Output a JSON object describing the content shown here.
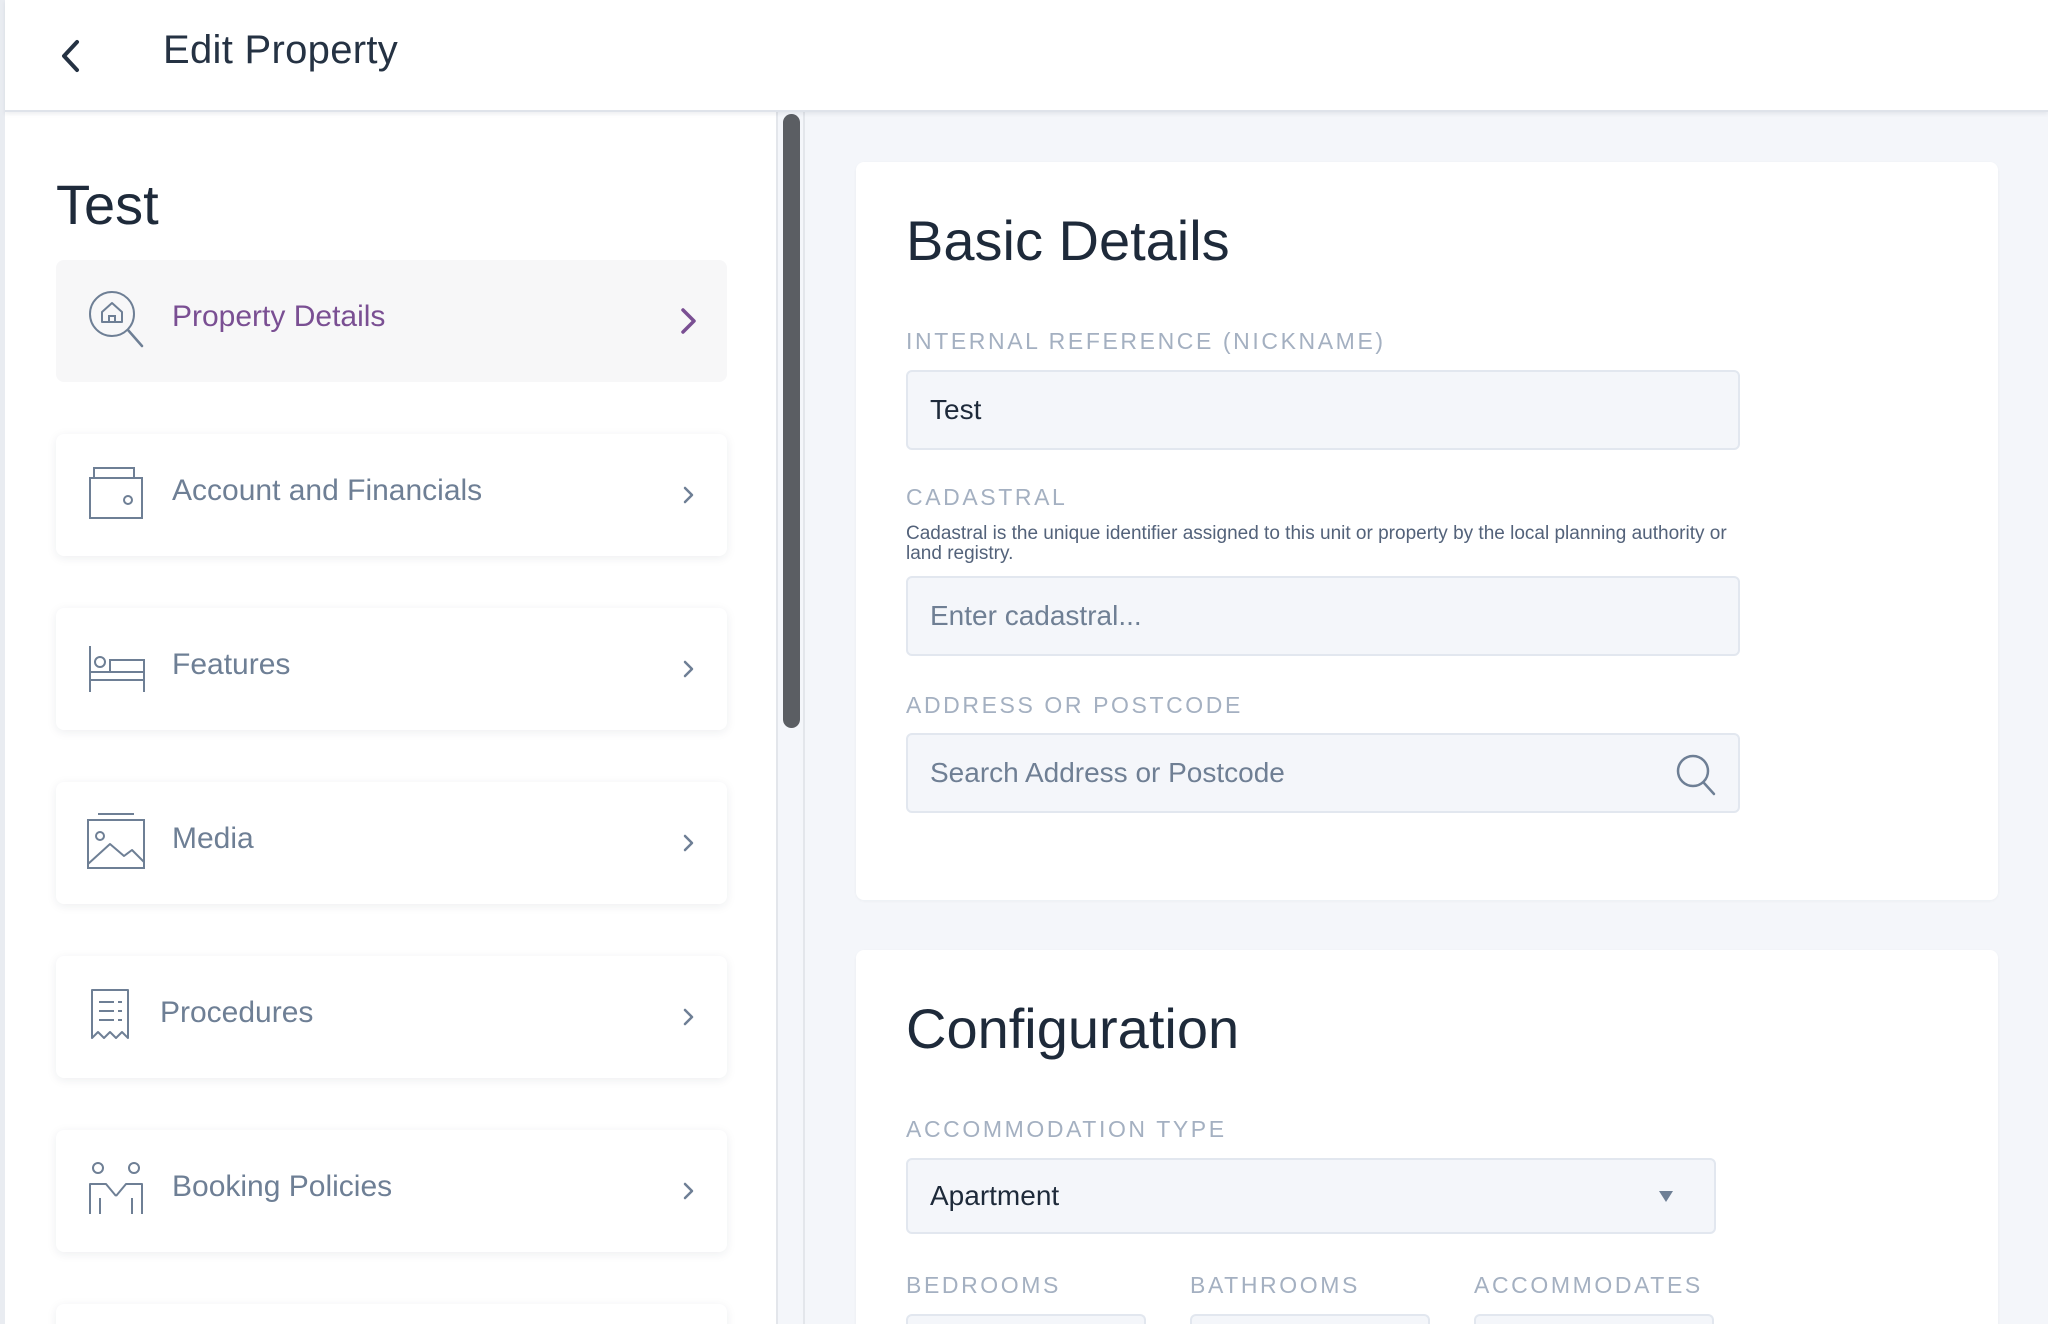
{
  "header": {
    "title": "Edit Property",
    "back_icon": "chevron-left-icon"
  },
  "sidebar": {
    "title": "Test",
    "items": [
      {
        "label": "Property Details",
        "icon": "house-search-icon",
        "active": true
      },
      {
        "label": "Account and Financials",
        "icon": "wallet-icon",
        "active": false
      },
      {
        "label": "Features",
        "icon": "bed-icon",
        "active": false
      },
      {
        "label": "Media",
        "icon": "image-icon",
        "active": false
      },
      {
        "label": "Procedures",
        "icon": "receipt-icon",
        "active": false
      },
      {
        "label": "Booking Policies",
        "icon": "people-icon",
        "active": false
      }
    ]
  },
  "basic_details": {
    "title": "Basic Details",
    "internal_reference": {
      "label": "INTERNAL REFERENCE (NICKNAME)",
      "value": "Test"
    },
    "cadastral": {
      "label": "CADASTRAL",
      "help": "Cadastral is the unique identifier assigned to this unit or property by the local planning authority or land registry.",
      "value": "",
      "placeholder": "Enter cadastral..."
    },
    "address": {
      "label": "ADDRESS OR POSTCODE",
      "value": "",
      "placeholder": "Search Address or Postcode"
    }
  },
  "configuration": {
    "title": "Configuration",
    "accommodation_type": {
      "label": "ACCOMMODATION TYPE",
      "value": "Apartment"
    },
    "bedrooms_label": "BEDROOMS",
    "bathrooms_label": "BATHROOMS",
    "accommodates_label": "ACCOMMODATES"
  },
  "colors": {
    "active_nav": "#7a4f93",
    "nav_text": "#6e7f95",
    "field_label": "#a4b0c1",
    "heading": "#1e2a3a",
    "page_background": "#f4f6fa"
  }
}
